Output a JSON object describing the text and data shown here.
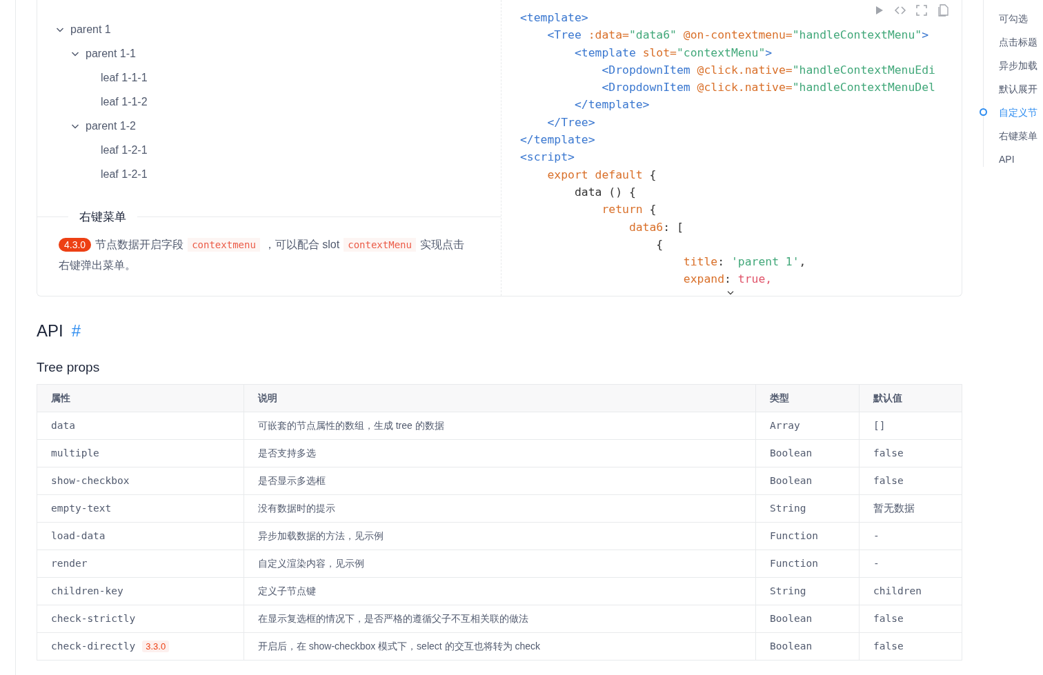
{
  "demo": {
    "tree": [
      {
        "title": "parent 1",
        "expanded": true,
        "children": [
          {
            "title": "parent 1-1",
            "expanded": true,
            "children": [
              {
                "title": "leaf 1-1-1"
              },
              {
                "title": "leaf 1-1-2"
              }
            ]
          },
          {
            "title": "parent 1-2",
            "expanded": true,
            "children": [
              {
                "title": "leaf 1-2-1"
              },
              {
                "title": "leaf 1-2-1"
              }
            ]
          }
        ]
      }
    ],
    "section_title": "右键菜单",
    "description": [
      {
        "kind": "badge",
        "text": "4.3.0"
      },
      {
        "kind": "text",
        "text": "节点数据开启字段"
      },
      {
        "kind": "code",
        "text": "contextmenu"
      },
      {
        "kind": "text",
        "text": "，可以配合 slot"
      },
      {
        "kind": "code",
        "text": "contextMenu"
      },
      {
        "kind": "text",
        "text": "实现点击"
      },
      {
        "kind": "text",
        "text": "右键弹出菜单。"
      }
    ]
  },
  "code": {
    "lines": [
      [
        {
          "kind": "tag",
          "text": "<template>"
        }
      ],
      [
        {
          "kind": "tag",
          "text": "    <Tree"
        },
        {
          "kind": "attr",
          "text": " :data="
        },
        {
          "kind": "string",
          "text": "\"data6\""
        },
        {
          "kind": "attr",
          "text": " @on-contextmenu="
        },
        {
          "kind": "string",
          "text": "\"handleContextMenu\""
        },
        {
          "kind": "tag",
          "text": ">"
        }
      ],
      [
        {
          "kind": "tag",
          "text": "        <template"
        },
        {
          "kind": "attr",
          "text": " slot="
        },
        {
          "kind": "string",
          "text": "\"contextMenu\""
        },
        {
          "kind": "tag",
          "text": ">"
        }
      ],
      [
        {
          "kind": "tag",
          "text": "            <DropdownItem"
        },
        {
          "kind": "attr",
          "text": " @click.native="
        },
        {
          "kind": "string",
          "text": "\"handleContextMenuEdi"
        }
      ],
      [
        {
          "kind": "tag",
          "text": "            <DropdownItem"
        },
        {
          "kind": "attr",
          "text": " @click.native="
        },
        {
          "kind": "string",
          "text": "\"handleContextMenuDel"
        }
      ],
      [
        {
          "kind": "tag",
          "text": "        </template>"
        }
      ],
      [
        {
          "kind": "tag",
          "text": "    </Tree>"
        }
      ],
      [
        {
          "kind": "tag",
          "text": "</template>"
        }
      ],
      [
        {
          "kind": "tag",
          "text": "<script>"
        }
      ],
      [
        {
          "kind": "keyword",
          "text": "    export default"
        },
        {
          "kind": "plain",
          "text": " {"
        }
      ],
      [
        {
          "kind": "plain",
          "text": "        data () {"
        }
      ],
      [
        {
          "kind": "keyword",
          "text": "            return"
        },
        {
          "kind": "plain",
          "text": " {"
        }
      ],
      [
        {
          "kind": "keyword",
          "text": "                data6"
        },
        {
          "kind": "plain",
          "text": ": ["
        }
      ],
      [
        {
          "kind": "plain",
          "text": "                    {"
        }
      ],
      [
        {
          "kind": "keyword",
          "text": "                        title"
        },
        {
          "kind": "plain",
          "text": ": "
        },
        {
          "kind": "string",
          "text": "'parent 1'"
        },
        {
          "kind": "plain",
          "text": ","
        }
      ],
      [
        {
          "kind": "keyword",
          "text": "                        expand"
        },
        {
          "kind": "plain",
          "text": ": "
        },
        {
          "kind": "literal",
          "text": "true,"
        }
      ]
    ]
  },
  "api": {
    "heading": "API",
    "anchor": "#",
    "subheading": "Tree props",
    "table": {
      "columns": [
        "属性",
        "说明",
        "类型",
        "默认值"
      ],
      "rows": [
        {
          "name": "data",
          "description": "可嵌套的节点属性的数组，生成 tree 的数据",
          "type": "Array",
          "default": "[]"
        },
        {
          "name": "multiple",
          "description": "是否支持多选",
          "type": "Boolean",
          "default": "false"
        },
        {
          "name": "show-checkbox",
          "description": "是否显示多选框",
          "type": "Boolean",
          "default": "false"
        },
        {
          "name": "empty-text",
          "description": "没有数据时的提示",
          "type": "String",
          "default": "暂无数据"
        },
        {
          "name": "load-data",
          "description": "异步加载数据的方法，见示例",
          "type": "Function",
          "default": "-"
        },
        {
          "name": "render",
          "description": "自定义渲染内容，见示例",
          "type": "Function",
          "default": "-"
        },
        {
          "name": "children-key",
          "description": "定义子节点键",
          "type": "String",
          "default": "children"
        },
        {
          "name": "check-strictly",
          "description": "在显示复选框的情况下，是否严格的遵循父子不互相关联的做法",
          "type": "Boolean",
          "default": "false"
        },
        {
          "name": "check-directly",
          "badge": "3.3.0",
          "description": "开启后，在 show-checkbox 模式下，select 的交互也将转为 check",
          "type": "Boolean",
          "default": "false"
        }
      ]
    }
  },
  "toc": [
    {
      "label": "可勾选",
      "selected": false
    },
    {
      "label": "点击标题",
      "selected": false
    },
    {
      "label": "异步加载",
      "selected": false
    },
    {
      "label": "默认展开",
      "selected": false
    },
    {
      "label": "自定义节",
      "selected": true
    },
    {
      "label": "右键菜单",
      "selected": false
    },
    {
      "label": "API",
      "selected": false
    }
  ]
}
